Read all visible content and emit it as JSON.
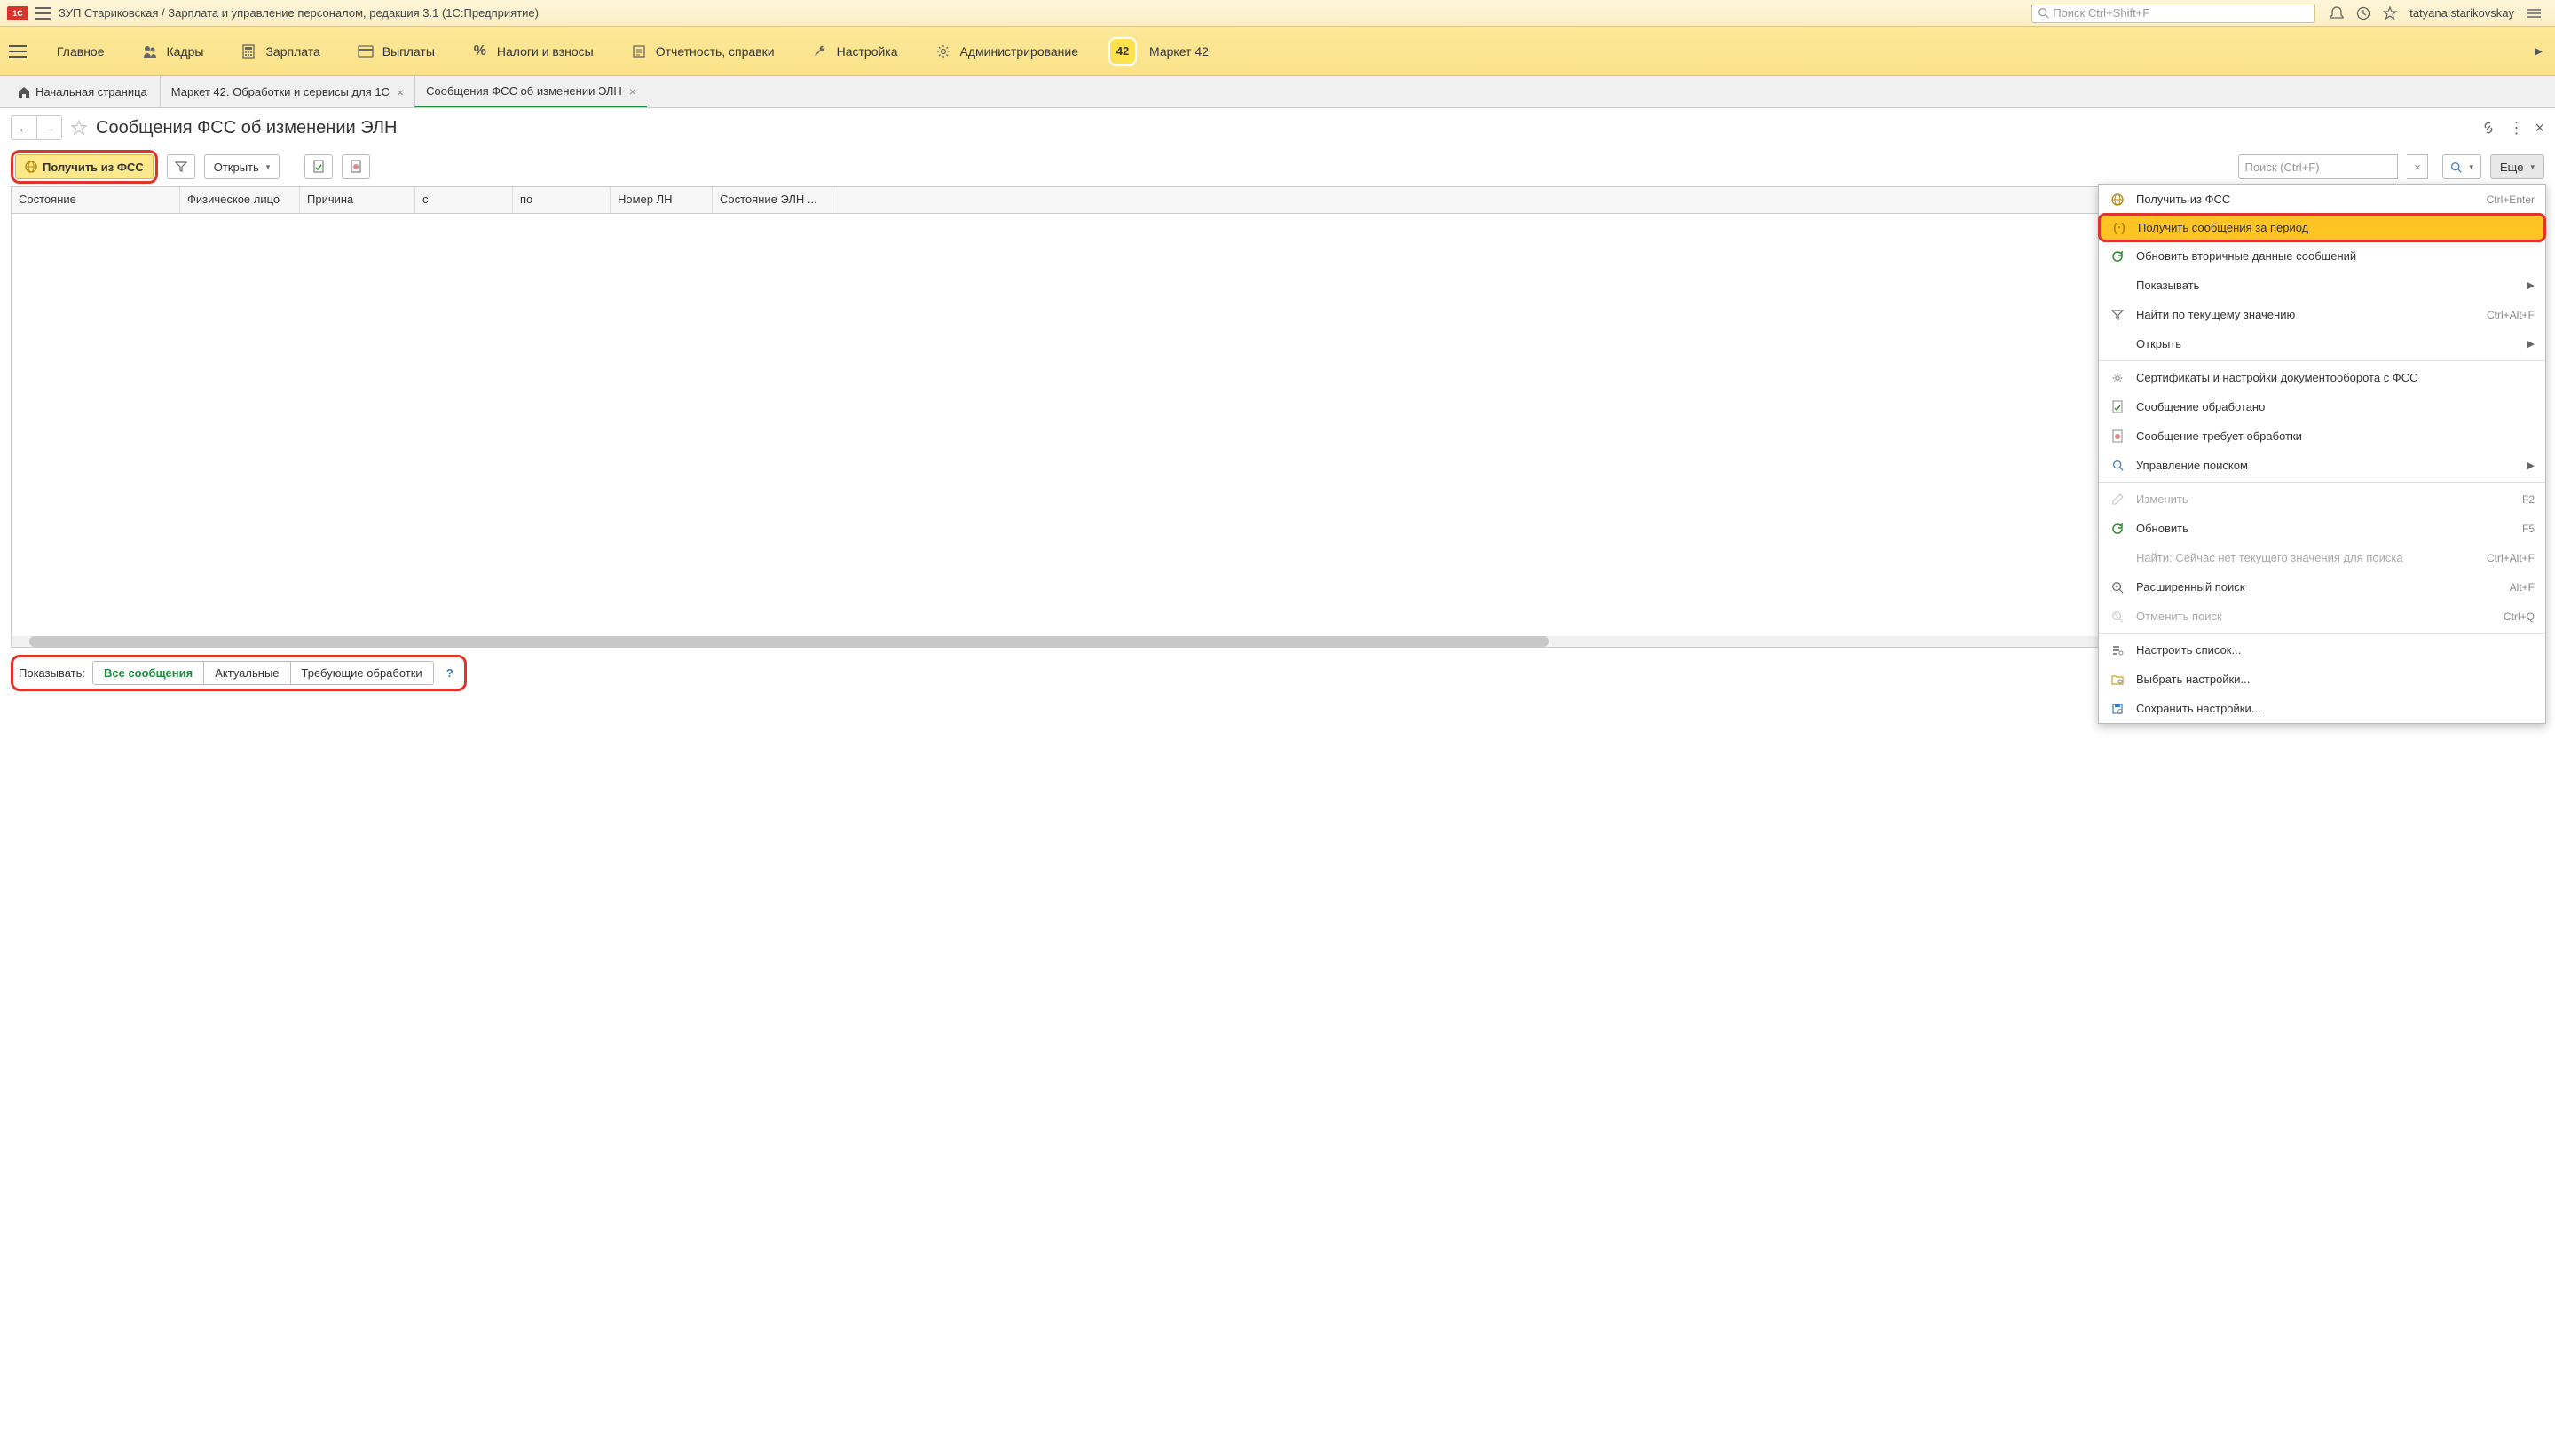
{
  "titlebar": {
    "app_title": "ЗУП Стариковская / Зарплата и управление персоналом, редакция 3.1  (1С:Предприятие)",
    "search_placeholder": "Поиск Ctrl+Shift+F",
    "user": "tatyana.starikovskay"
  },
  "menu": {
    "items": [
      {
        "label": "Главное"
      },
      {
        "label": "Кадры"
      },
      {
        "label": "Зарплата"
      },
      {
        "label": "Выплаты"
      },
      {
        "label": "Налоги и взносы"
      },
      {
        "label": "Отчетность, справки"
      },
      {
        "label": "Настройка"
      },
      {
        "label": "Администрирование"
      }
    ],
    "market_badge": "42",
    "market_label": "Маркет 42"
  },
  "tabs": {
    "home": "Начальная страница",
    "items": [
      {
        "label": "Маркет 42. Обработки и сервисы для 1С",
        "active": false
      },
      {
        "label": "Сообщения ФСС об изменении ЭЛН",
        "active": true
      }
    ]
  },
  "page": {
    "title": "Сообщения ФСС об изменении ЭЛН"
  },
  "toolbar": {
    "get_from_fss": "Получить из ФСС",
    "open": "Открыть",
    "search_placeholder": "Поиск (Ctrl+F)",
    "more": "Еще"
  },
  "table": {
    "columns": [
      {
        "label": "Состояние",
        "width": 190
      },
      {
        "label": "Физическое лицо",
        "width": 135
      },
      {
        "label": "Причина",
        "width": 130
      },
      {
        "label": "с",
        "width": 110
      },
      {
        "label": "по",
        "width": 110
      },
      {
        "label": "Номер ЛН",
        "width": 115
      },
      {
        "label": "Состояние ЭЛН ...",
        "width": 135
      }
    ]
  },
  "context_menu": {
    "items": [
      {
        "icon": "globe",
        "label": "Получить из ФСС",
        "shortcut": "Ctrl+Enter"
      },
      {
        "icon": "signal",
        "label": "Получить сообщения за период",
        "highlighted": true
      },
      {
        "icon": "refresh",
        "label": "Обновить вторичные данные сообщений"
      },
      {
        "label": "Показывать",
        "submenu": true
      },
      {
        "icon": "filter",
        "label": "Найти по текущему значению",
        "shortcut": "Ctrl+Alt+F"
      },
      {
        "label": "Открыть",
        "submenu": true
      },
      {
        "separator": true
      },
      {
        "icon": "gear",
        "label": "Сертификаты и настройки документооборота с ФСС"
      },
      {
        "icon": "doc-check",
        "label": "Сообщение обработано"
      },
      {
        "icon": "doc-alert",
        "label": "Сообщение требует обработки"
      },
      {
        "icon": "search",
        "label": "Управление поиском",
        "submenu": true
      },
      {
        "separator": true
      },
      {
        "icon": "pencil",
        "label": "Изменить",
        "shortcut": "F2",
        "disabled": true
      },
      {
        "icon": "refresh",
        "label": "Обновить",
        "shortcut": "F5"
      },
      {
        "label": "Найти: Сейчас нет текущего значения для поиска",
        "shortcut": "Ctrl+Alt+F",
        "disabled": true
      },
      {
        "icon": "search-adv",
        "label": "Расширенный поиск",
        "shortcut": "Alt+F"
      },
      {
        "icon": "search-cancel",
        "label": "Отменить поиск",
        "shortcut": "Ctrl+Q",
        "disabled": true
      },
      {
        "separator": true
      },
      {
        "icon": "list-gear",
        "label": "Настроить список..."
      },
      {
        "icon": "folder-gear",
        "label": "Выбрать настройки..."
      },
      {
        "icon": "save-gear",
        "label": "Сохранить настройки..."
      }
    ]
  },
  "footer": {
    "label": "Показывать:",
    "segments": [
      "Все сообщения",
      "Актуальные",
      "Требующие обработки"
    ],
    "active_segment": 0
  }
}
